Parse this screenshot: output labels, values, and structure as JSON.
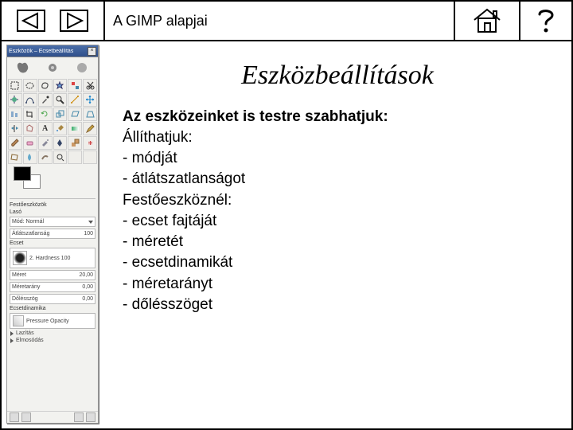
{
  "topbar": {
    "title": "A GIMP alapjai"
  },
  "toolbox": {
    "window_title": "Eszközök – Ecsetbeállítás",
    "section_label": "Festőeszközök",
    "mode_label": "Lasó",
    "mode_value": "Mód: Normál",
    "opacity_label": "Átlátszatlanság",
    "opacity_value": "100",
    "brush_label": "Ecset",
    "brush_name": "2. Hardness 100",
    "size_label": "Méret",
    "size_value": "20,00",
    "ratio_label": "Méretarány",
    "ratio_value": "0,00",
    "angle_label": "Dőlésszög",
    "angle_value": "0,00",
    "dynamics_label": "Ecsetdinamika",
    "dynamics_value": "Pressure Opacity",
    "link1": "Lazítás",
    "link2": "Elmosódás"
  },
  "content": {
    "heading": "Eszközbeállítások",
    "lead": "Az eszközeinket is testre szabhatjuk:",
    "lines": [
      "Állíthatjuk:",
      "- módját",
      "- átlátszatlanságot",
      "Festőeszköznél:",
      "- ecset fajtáját",
      "- méretét",
      "- ecsetdinamikát",
      "- méretarányt",
      "- dőlésszöget"
    ]
  }
}
